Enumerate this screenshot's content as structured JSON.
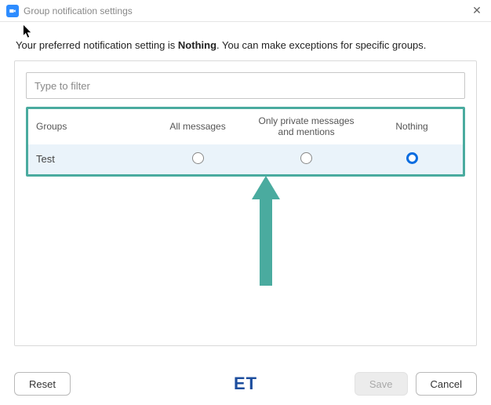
{
  "window": {
    "title": "Group notification settings"
  },
  "subtitle": {
    "prefix": "Your preferred notification setting is ",
    "bold": "Nothing",
    "suffix": ". You can make exceptions for specific groups."
  },
  "filter": {
    "placeholder": "Type to filter",
    "value": ""
  },
  "columns": {
    "groups": "Groups",
    "all": "All messages",
    "private": "Only private messages and mentions",
    "nothing": "Nothing"
  },
  "rows": [
    {
      "name": "Test",
      "selection": "nothing"
    }
  ],
  "buttons": {
    "reset": "Reset",
    "save": "Save",
    "cancel": "Cancel"
  },
  "watermark": "ET"
}
